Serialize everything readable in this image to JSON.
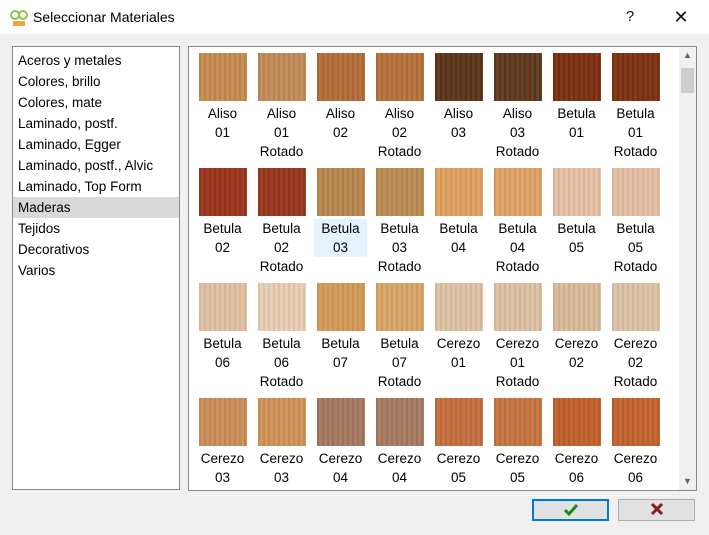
{
  "window": {
    "title": "Seleccionar Materiales",
    "help_label": "?",
    "close_label": "✕"
  },
  "categories": [
    {
      "label": "Aceros y metales"
    },
    {
      "label": "Colores, brillo"
    },
    {
      "label": "Colores, mate"
    },
    {
      "label": "Laminado, postf."
    },
    {
      "label": "Laminado, Egger"
    },
    {
      "label": "Laminado, postf., Alvic"
    },
    {
      "label": "Laminado, Top Form"
    },
    {
      "label": "Maderas",
      "selected": true
    },
    {
      "label": "Tejidos"
    },
    {
      "label": "Decorativos"
    },
    {
      "label": "Varios"
    }
  ],
  "materials": [
    {
      "lines": [
        "Aliso",
        "01"
      ],
      "color": "#c68a4f"
    },
    {
      "lines": [
        "Aliso",
        "01",
        "Rotado"
      ],
      "color": "#c08a55"
    },
    {
      "lines": [
        "Aliso",
        "02"
      ],
      "color": "#b36a35"
    },
    {
      "lines": [
        "Aliso",
        "02",
        "Rotado"
      ],
      "color": "#b5703c"
    },
    {
      "lines": [
        "Aliso",
        "03"
      ],
      "color": "#5a3418"
    },
    {
      "lines": [
        "Aliso",
        "03",
        "Rotado"
      ],
      "color": "#5e381c"
    },
    {
      "lines": [
        "Betula",
        "01"
      ],
      "color": "#7a2e0c"
    },
    {
      "lines": [
        "Betula",
        "01",
        "Rotado"
      ],
      "color": "#7d300e"
    },
    {
      "lines": [
        "Betula",
        "02"
      ],
      "color": "#9a3418"
    },
    {
      "lines": [
        "Betula",
        "02",
        "Rotado"
      ],
      "color": "#98361c"
    },
    {
      "lines": [
        "Betula",
        "03"
      ],
      "color": "#b8874e",
      "selected": true
    },
    {
      "lines": [
        "Betula",
        "03",
        "Rotado"
      ],
      "color": "#bc8c54"
    },
    {
      "lines": [
        "Betula",
        "04"
      ],
      "color": "#e0a060"
    },
    {
      "lines": [
        "Betula",
        "04",
        "Rotado"
      ],
      "color": "#dfa264"
    },
    {
      "lines": [
        "Betula",
        "05"
      ],
      "color": "#e6c0a4"
    },
    {
      "lines": [
        "Betula",
        "05",
        "Rotado"
      ],
      "color": "#e4bea2"
    },
    {
      "lines": [
        "Betula",
        "06"
      ],
      "color": "#e2c0a0"
    },
    {
      "lines": [
        "Betula",
        "06",
        "Rotado"
      ],
      "color": "#e8cdb2"
    },
    {
      "lines": [
        "Betula",
        "07"
      ],
      "color": "#d29a56"
    },
    {
      "lines": [
        "Betula",
        "07",
        "Rotado"
      ],
      "color": "#d8a464"
    },
    {
      "lines": [
        "Cerezo",
        "01"
      ],
      "color": "#ddc2a4"
    },
    {
      "lines": [
        "Cerezo",
        "01",
        "Rotado"
      ],
      "color": "#dcc0a0"
    },
    {
      "lines": [
        "Cerezo",
        "02"
      ],
      "color": "#d9ba98"
    },
    {
      "lines": [
        "Cerezo",
        "02",
        "Rotado"
      ],
      "color": "#dcc2a6"
    },
    {
      "lines": [
        "Cerezo",
        "03"
      ],
      "color": "#cc8d55"
    },
    {
      "lines": [
        "Cerezo",
        "03"
      ],
      "color": "#d09256"
    },
    {
      "lines": [
        "Cerezo",
        "04"
      ],
      "color": "#a4785e"
    },
    {
      "lines": [
        "Cerezo",
        "04"
      ],
      "color": "#a67a60"
    },
    {
      "lines": [
        "Cerezo",
        "05"
      ],
      "color": "#c66d3c"
    },
    {
      "lines": [
        "Cerezo",
        "05"
      ],
      "color": "#c87440"
    },
    {
      "lines": [
        "Cerezo",
        "06"
      ],
      "color": "#c0602a"
    },
    {
      "lines": [
        "Cerezo",
        "06"
      ],
      "color": "#c2622c"
    }
  ],
  "buttons": {
    "ok_color": "#1a8a1a",
    "cancel_color": "#8b1a1a"
  },
  "colors": {
    "selection": "#e5f3ff",
    "category_selection": "#d9d9d9"
  }
}
